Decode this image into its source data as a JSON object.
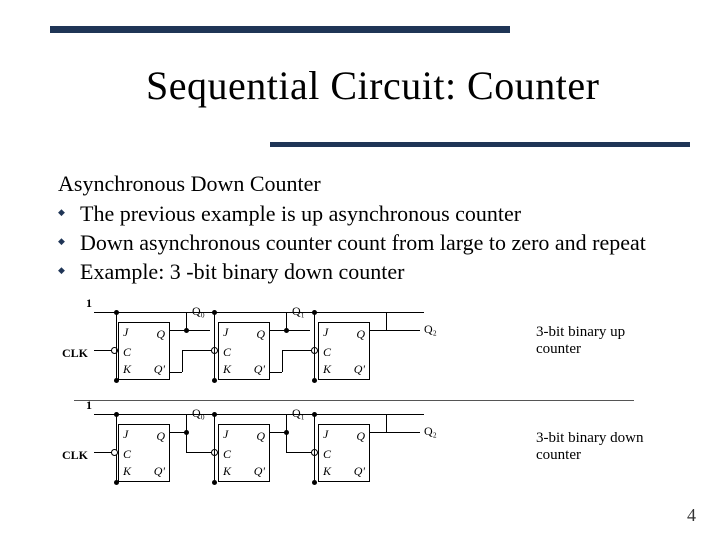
{
  "title": "Sequential Circuit: Counter",
  "subtitle": "Asynchronous Down Counter",
  "bullets": [
    "The previous example is up asynchronous counter",
    "Down asynchronous counter count from large to zero and repeat",
    "Example: 3 -bit binary down counter"
  ],
  "diagram": {
    "input_high": "1",
    "clk_label": "CLK",
    "ff_labels": {
      "j": "J",
      "k": "K",
      "c": "C",
      "q": "Q",
      "qb": "Q'"
    },
    "outputs": [
      "Q₀",
      "Q₁",
      "Q₂"
    ],
    "captions": {
      "up": "3-bit binary up counter",
      "down": "3-bit binary down counter"
    }
  },
  "page_number": "4"
}
